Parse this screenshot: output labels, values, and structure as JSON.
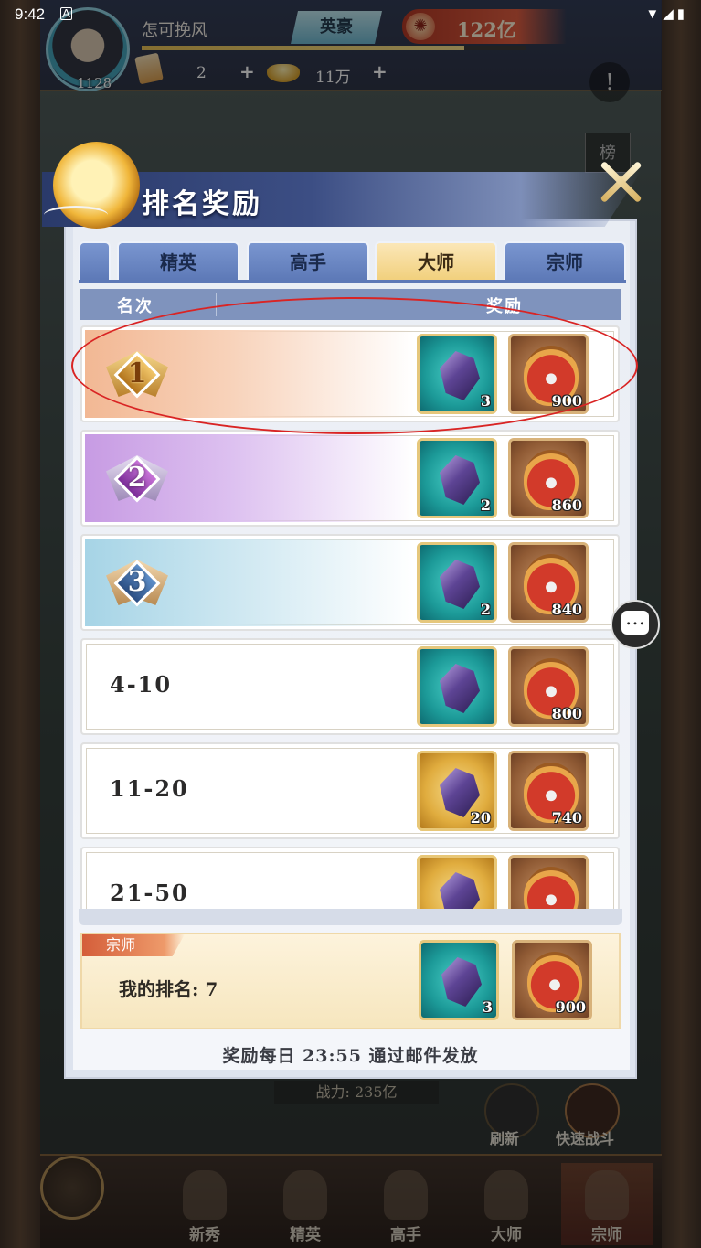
{
  "status_bar": {
    "time": "9:42",
    "notification": "A",
    "icons": "▼◢▮"
  },
  "hud": {
    "level": "1128",
    "player_name": "怎可挽风",
    "rank_badge": "英豪",
    "power": "122亿",
    "power_icon": "flame-icon",
    "exp_progress": 0.84,
    "resource_1": "2",
    "resource_2": "11万",
    "plus": "+",
    "warning_symbol": "!",
    "board_label": "榜"
  },
  "panel": {
    "title": "排名奖励",
    "tabs": [
      {
        "label": ""
      },
      {
        "label": "精英"
      },
      {
        "label": "高手"
      },
      {
        "label": "大师",
        "active": true
      },
      {
        "label": "宗师"
      }
    ],
    "columns": {
      "rank": "名次",
      "reward": "奖励"
    },
    "rows": [
      {
        "rank": "1",
        "style": "gold",
        "rewards": [
          {
            "icon": "crystal-teal-icon",
            "qty": "3"
          },
          {
            "icon": "token-icon",
            "qty": "900"
          }
        ]
      },
      {
        "rank": "2",
        "style": "purple",
        "rewards": [
          {
            "icon": "crystal-teal-icon",
            "qty": "2"
          },
          {
            "icon": "token-icon",
            "qty": "860"
          }
        ]
      },
      {
        "rank": "3",
        "style": "blue",
        "rewards": [
          {
            "icon": "crystal-teal-icon",
            "qty": "2"
          },
          {
            "icon": "token-icon",
            "qty": "840"
          }
        ]
      },
      {
        "rank": "4-10",
        "rewards": [
          {
            "icon": "crystal-teal-icon",
            "qty": ""
          },
          {
            "icon": "token-icon",
            "qty": "800"
          }
        ]
      },
      {
        "rank": "11-20",
        "rewards": [
          {
            "icon": "crystal-gold-icon",
            "qty": "20"
          },
          {
            "icon": "token-icon",
            "qty": "740"
          }
        ]
      },
      {
        "rank": "21-50",
        "rewards": [
          {
            "icon": "crystal-gold-icon",
            "qty": ""
          },
          {
            "icon": "token-icon",
            "qty": ""
          }
        ]
      }
    ],
    "my_rank": {
      "tier": "宗师",
      "label": "我的排名: 7",
      "rewards": [
        {
          "icon": "crystal-teal-icon",
          "qty": "3"
        },
        {
          "icon": "token-icon",
          "qty": "900"
        }
      ]
    },
    "footer_note": "奖励每日 23:55 通过邮件发放"
  },
  "background": {
    "battle_power": "战力: 235亿",
    "refresh_label": "刷新",
    "fast_battle_label": "快速战斗",
    "nav": [
      "新秀",
      "精英",
      "高手",
      "大师",
      "宗师"
    ]
  },
  "colors": {
    "highlight": "#d92424",
    "active_tab": "#f1cf7a",
    "tab": "#5c78b6"
  }
}
